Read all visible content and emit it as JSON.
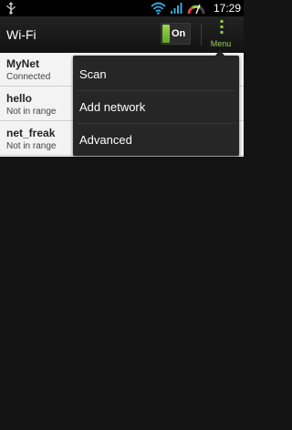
{
  "status_bar": {
    "time": "17:29",
    "icons": [
      "usb-icon",
      "wifi-icon",
      "signal-icon",
      "battery-icon"
    ]
  },
  "header": {
    "title": "Wi-Fi",
    "toggle_label": "On",
    "toggle_on": true,
    "menu_label": "Menu"
  },
  "networks": [
    {
      "name": "MyNet",
      "status": "Connected"
    },
    {
      "name": "hello",
      "status": "Not in range"
    },
    {
      "name": "net_freak",
      "status": "Not in range"
    }
  ],
  "overflow_menu": {
    "items": [
      {
        "label": "Scan"
      },
      {
        "label": "Add network"
      },
      {
        "label": "Advanced"
      }
    ]
  },
  "colors": {
    "accent": "#7bbf3a",
    "menu_background": "#262626",
    "list_background": "#f3f3f3"
  }
}
